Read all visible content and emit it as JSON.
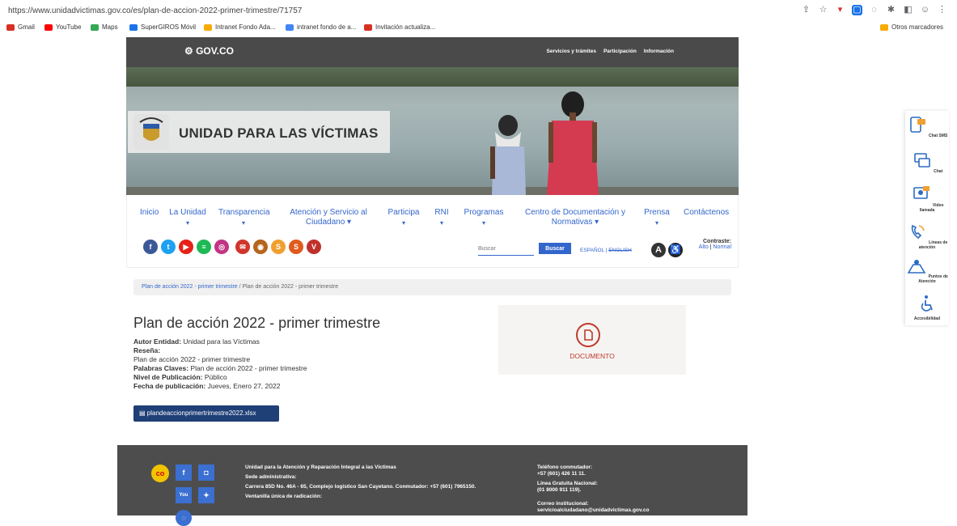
{
  "browser": {
    "url": "https://www.unidadvictimas.gov.co/es/plan-de-accion-2022-primer-trimestre/71757",
    "bookmarks": [
      {
        "label": "Gmail",
        "color": "#d93025"
      },
      {
        "label": "YouTube",
        "color": "#ff0000"
      },
      {
        "label": "Maps",
        "color": "#34a853"
      },
      {
        "label": "SuperGIROS Móvil",
        "color": "#1a73e8"
      },
      {
        "label": "Intranet Fondo Ada...",
        "color": "#f9ab00"
      },
      {
        "label": "intranet fondo de a...",
        "color": "#4285f4"
      },
      {
        "label": "Invitación actualiza...",
        "color": "#d93025"
      }
    ],
    "other_bookmarks": "Otros marcadores"
  },
  "gov": {
    "logo": "GOV.CO",
    "nav": [
      "Servicios y trámites",
      "Participación",
      "Información"
    ]
  },
  "brand": {
    "title": "UNIDAD PARA LAS VÍCTIMAS"
  },
  "nav": {
    "inicio": "Inicio",
    "la_unidad": "La Unidad",
    "transparencia": "Transparencia",
    "atencion": "Atención y Servicio al Ciudadano",
    "participa": "Participa",
    "rni": "RNI",
    "programas": "Programas",
    "centro": "Centro de Documentación y Normativas",
    "prensa": "Prensa",
    "contactenos": "Contáctenos"
  },
  "tools": {
    "search_placeholder": "Buscar",
    "search_button": "Buscar",
    "lang_es": "ESPAÑOL",
    "lang_en": "ENGLISH",
    "contrast_label": "Contraste:",
    "contrast_high": "Alto",
    "contrast_normal": "Normal"
  },
  "breadcrumb": {
    "link": "Plan de acción 2022 - primer trimestre",
    "current": "Plan de acción 2022 - primer trimestre"
  },
  "content": {
    "title": "Plan de acción 2022 - primer trimestre",
    "autor_label": "Autor Entidad:",
    "autor_value": "Unidad para las Víctimas",
    "resena_label": "Reseña:",
    "resena_value": "Plan de acción 2022 - primer trimestre",
    "palabras_label": "Palabras Claves:",
    "palabras_value": "Plan de acción 2022 - primer trimestre",
    "nivel_label": "Nivel de Publicación:",
    "nivel_value": "Público",
    "fecha_label": "Fecha de publicación:",
    "fecha_value": "Jueves, Enero 27, 2022",
    "file_name": "plandeaccionprimertrimestre2022.xlsx",
    "doc_label": "DOCUMENTO"
  },
  "footer": {
    "entity": "Unidad para la Atención y Reparación Integral a las Víctimas",
    "sede_label": "Sede administrativa:",
    "sede_value": "Carrera 85D No. 46A - 65, Complejo logístico San Cayetano. Conmutador: +57 (601) 7965150.",
    "ventanilla": "Ventanilla única de radicación:",
    "tel_label": "Teléfono conmutador:",
    "tel_value": "+57 (601) 426 11 11.",
    "linea_label": "Línea Gratuita Nacional:",
    "linea_value": "(01 8000 911 119).",
    "correo_label": "Correo institucional:",
    "correo_value": "servicioalciudadano@unidadvictimas.gov.co"
  },
  "sidebar": [
    "Chat SMS",
    "Chat",
    "Video llamada",
    "Líneas de atención",
    "Puntos de Atención",
    "Accesibilidad"
  ]
}
